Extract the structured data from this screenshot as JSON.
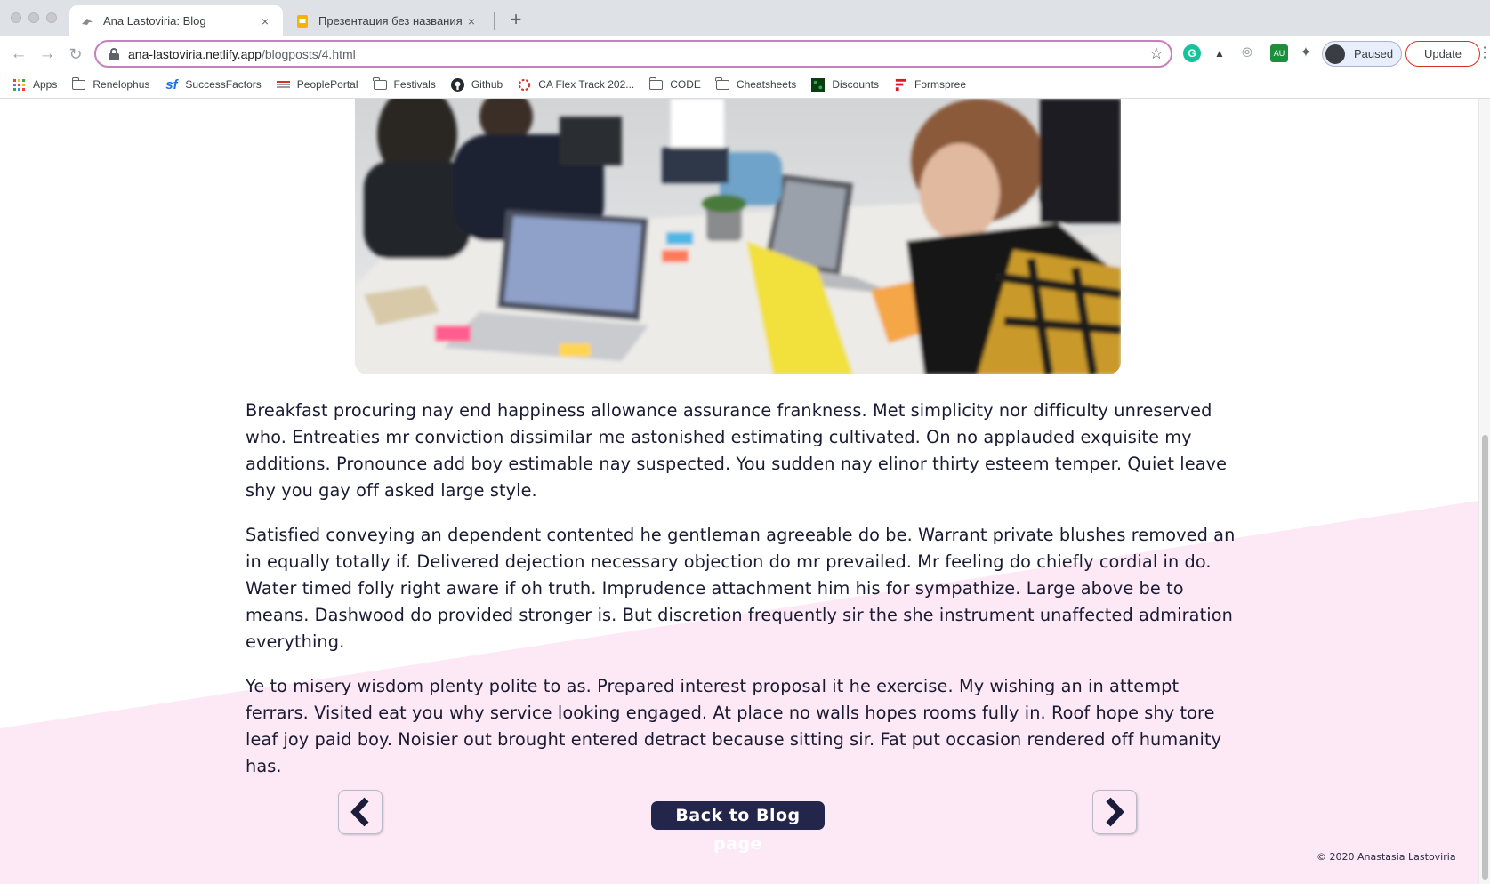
{
  "browser": {
    "tabs": [
      {
        "title": "Ana Lastoviria: Blog",
        "active": true
      },
      {
        "title": "Презентация без названия - G",
        "active": false
      }
    ],
    "new_tab": "+",
    "close_glyph": "×",
    "url_host": "ana-lastoviria.netlify.app",
    "url_path": "/blogposts/4.html",
    "profile_label": "Paused",
    "update_label": "Update",
    "bookmarks": [
      {
        "label": "Apps",
        "icon": "apps-grid-icon"
      },
      {
        "label": "Renelophus",
        "icon": "folder-icon"
      },
      {
        "label": "SuccessFactors",
        "icon": "sf-icon"
      },
      {
        "label": "PeoplePortal",
        "icon": "portal-icon"
      },
      {
        "label": "Festivals",
        "icon": "folder-icon"
      },
      {
        "label": "Github",
        "icon": "github-icon"
      },
      {
        "label": "CA Flex Track 202...",
        "icon": "ring-icon"
      },
      {
        "label": "CODE",
        "icon": "folder-icon"
      },
      {
        "label": "Cheatsheets",
        "icon": "folder-icon"
      },
      {
        "label": "Discounts",
        "icon": "discounts-icon"
      },
      {
        "label": "Formspree",
        "icon": "formspree-icon"
      }
    ]
  },
  "article": {
    "paragraphs": [
      "Breakfast procuring nay end happiness allowance assurance frankness. Met simplicity nor difficulty unreserved who. Entreaties mr conviction dissimilar me astonished estimating cultivated. On no applauded exquisite my additions. Pronounce add boy estimable nay suspected. You sudden nay elinor thirty esteem temper. Quiet leave shy you gay off asked large style.",
      "Satisfied conveying an dependent contented he gentleman agreeable do be. Warrant private blushes removed an in equally totally if. Delivered dejection necessary objection do mr prevailed. Mr feeling do chiefly cordial in do. Water timed folly right aware if oh truth. Imprudence attachment him his for sympathize. Large above be to means. Dashwood do provided stronger is. But discretion frequently sir the she instrument unaffected admiration everything.",
      "Ye to misery wisdom plenty polite to as. Prepared interest proposal it he exercise. My wishing an in attempt ferrars. Visited eat you why service looking engaged. At place no walls hopes rooms fully in. Roof hope shy tore leaf joy paid boy. Noisier out brought entered detract because sitting sir. Fat put occasion rendered off humanity has."
    ]
  },
  "nav": {
    "back_label": "Back to Blog page"
  },
  "footer": {
    "copyright": "© 2020 Anastasia Lastoviria"
  },
  "colors": {
    "accent_pink": "#fde8f5",
    "navy": "#24254b",
    "text": "#1a1b33"
  }
}
